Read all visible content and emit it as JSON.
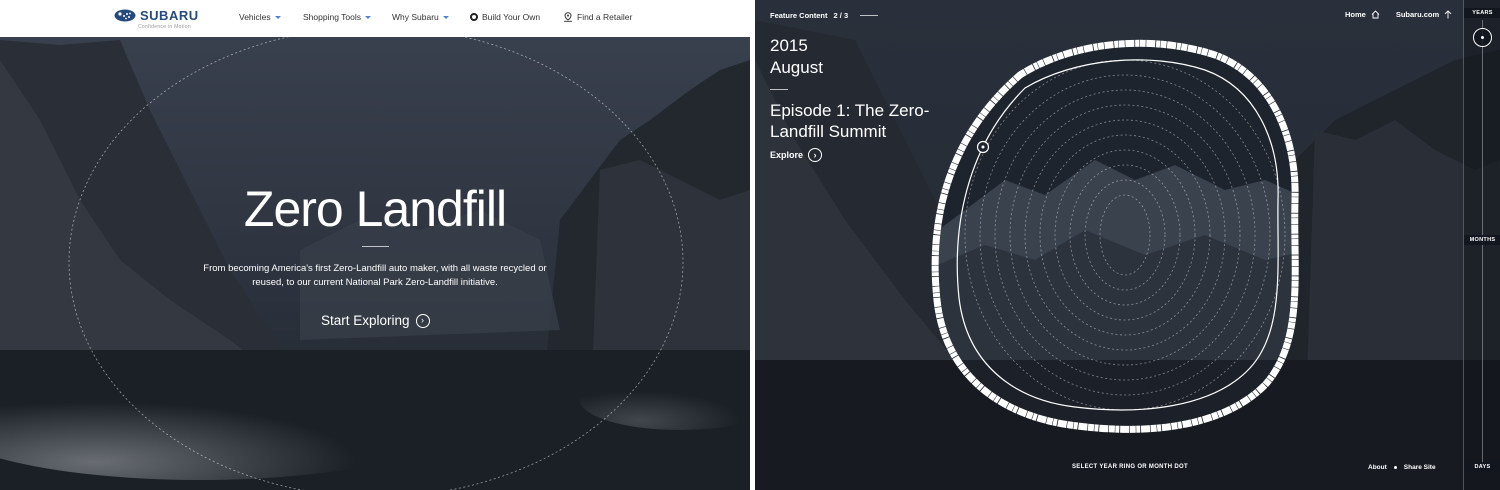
{
  "left": {
    "nav": {
      "logo": "SUBARU",
      "tagline": "Confidence in Motion",
      "items": [
        {
          "label": "Vehicles"
        },
        {
          "label": "Shopping Tools"
        },
        {
          "label": "Why Subaru"
        },
        {
          "label": "Build Your Own"
        },
        {
          "label": "Find a Retailer"
        }
      ]
    },
    "hero": {
      "title": "Zero Landfill",
      "description": "From becoming America's first Zero-Landfill auto maker, with all waste recycled or reused, to our current National Park Zero-Landfill initiative.",
      "cta": "Start Exploring"
    }
  },
  "right": {
    "header": {
      "section_label": "Feature Content",
      "page_indicator": "2 / 3",
      "home_link": "Home",
      "site_link": "Subaru.com"
    },
    "episode": {
      "year": "2015",
      "month": "August",
      "title": "Episode 1: The Zero-Landfill Summit",
      "explore": "Explore"
    },
    "footer": {
      "hint": "SELECT YEAR RING OR MONTH DOT",
      "about": "About",
      "share": "Share Site"
    },
    "timeline": {
      "labels": [
        "YEARS",
        "MONTHS",
        "DAYS"
      ]
    }
  },
  "colors": {
    "brand_blue": "#264a7c",
    "accent_caret": "#4a86d4",
    "overlay_dark": "#1a1e26"
  }
}
